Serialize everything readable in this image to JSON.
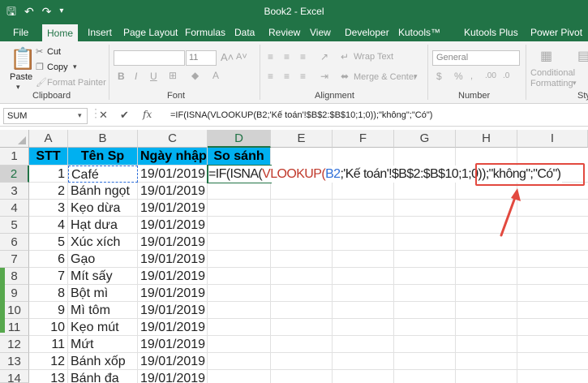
{
  "title_bar": {
    "doc_title": "Book2  -  Excel",
    "qat_icons": [
      "save-icon",
      "undo-icon",
      "redo-icon",
      "customize-icon"
    ]
  },
  "tabs": [
    "File",
    "Home",
    "Insert",
    "Page Layout",
    "Formulas",
    "Data",
    "Review",
    "View",
    "Developer",
    "Kutools™",
    "Kutools Plus",
    "Power Pivot"
  ],
  "active_tab": "Home",
  "ribbon": {
    "clipboard": {
      "paste": "Paste",
      "cut": "Cut",
      "copy": "Copy",
      "format_painter": "Format Painter",
      "label": "Clipboard"
    },
    "font": {
      "font_name": "",
      "font_size": "11",
      "bold": "B",
      "italic": "I",
      "underline": "U",
      "label": "Font"
    },
    "alignment": {
      "wrap_text": "Wrap Text",
      "merge_center": "Merge & Center",
      "label": "Alignment"
    },
    "number": {
      "format": "General",
      "label": "Number"
    },
    "styles": {
      "conditional": "Conditional",
      "formatting": "Formatting",
      "label": "Styl"
    }
  },
  "formula_bar": {
    "name_box": "SUM",
    "formula": "=IF(ISNA(VLOOKUP(B2;'Kế toán'!$B$2:$B$10;1;0));\"không\";\"Có\")"
  },
  "columns": [
    "A",
    "B",
    "C",
    "D",
    "E",
    "F",
    "G",
    "H",
    "I"
  ],
  "rows": [
    "1",
    "2",
    "3",
    "4",
    "5",
    "6",
    "7",
    "8",
    "9",
    "10",
    "11",
    "12",
    "13",
    "14"
  ],
  "table": {
    "headers": [
      "STT",
      "Tên Sp",
      "Ngày nhập",
      "So sánh"
    ],
    "stt": [
      "1",
      "2",
      "3",
      "4",
      "5",
      "6",
      "7",
      "8",
      "9",
      "10",
      "11",
      "12",
      "13"
    ],
    "products": [
      "Café",
      "Bánh ngọt",
      "Kẹo dừa",
      "Hạt dưa",
      "Xúc xích",
      "Gạo",
      "Mít sấy",
      "Bột mì",
      "Mì tôm",
      "Kẹo mút",
      "Mứt",
      "Bánh xốp",
      "Bánh đa"
    ],
    "date": "19/01/2019"
  },
  "editing_formula": {
    "p1": "=IF(ISNA(",
    "p2": "VLOOKUP(",
    "p3": "B2",
    "p4": ";'Kế toán'!$B$2:$B$10;",
    "p5": "1;0));\"không\";\"Có\")"
  },
  "colors": {
    "excel_green": "#217346",
    "header_fill": "#00b0f0",
    "annotation_red": "#e2493f"
  }
}
